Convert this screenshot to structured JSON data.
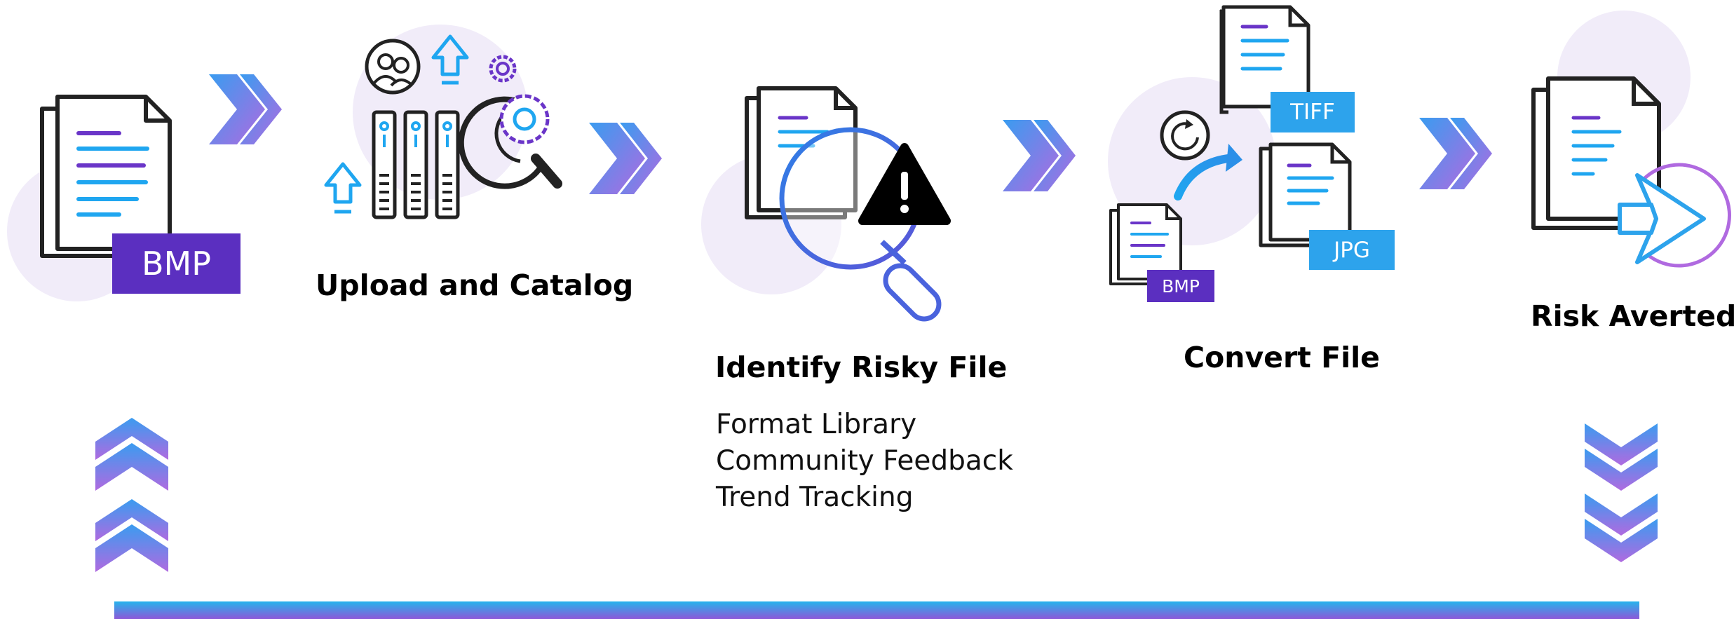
{
  "colors": {
    "purple": "#6a35c8",
    "blue": "#1fa6f0",
    "circle_bg": "#f1ecf9",
    "tag_blue": "#2da3ec",
    "tag_purple": "#5b2fc0"
  },
  "steps": [
    {
      "icon": "bmp-file-icon",
      "tag": "BMP"
    },
    {
      "icon": "server-upload-icon",
      "title": "Upload and Catalog"
    },
    {
      "icon": "magnifier-warning-icon",
      "title": "Identify Risky File",
      "bullets": [
        "Format Library",
        "Community Feedback",
        "Trend Tracking"
      ]
    },
    {
      "icon": "file-convert-icon",
      "title": "Convert File",
      "tags": [
        "TIFF",
        "JPG",
        "BMP"
      ]
    },
    {
      "icon": "file-arrow-icon",
      "title": "Risk Averted"
    }
  ]
}
